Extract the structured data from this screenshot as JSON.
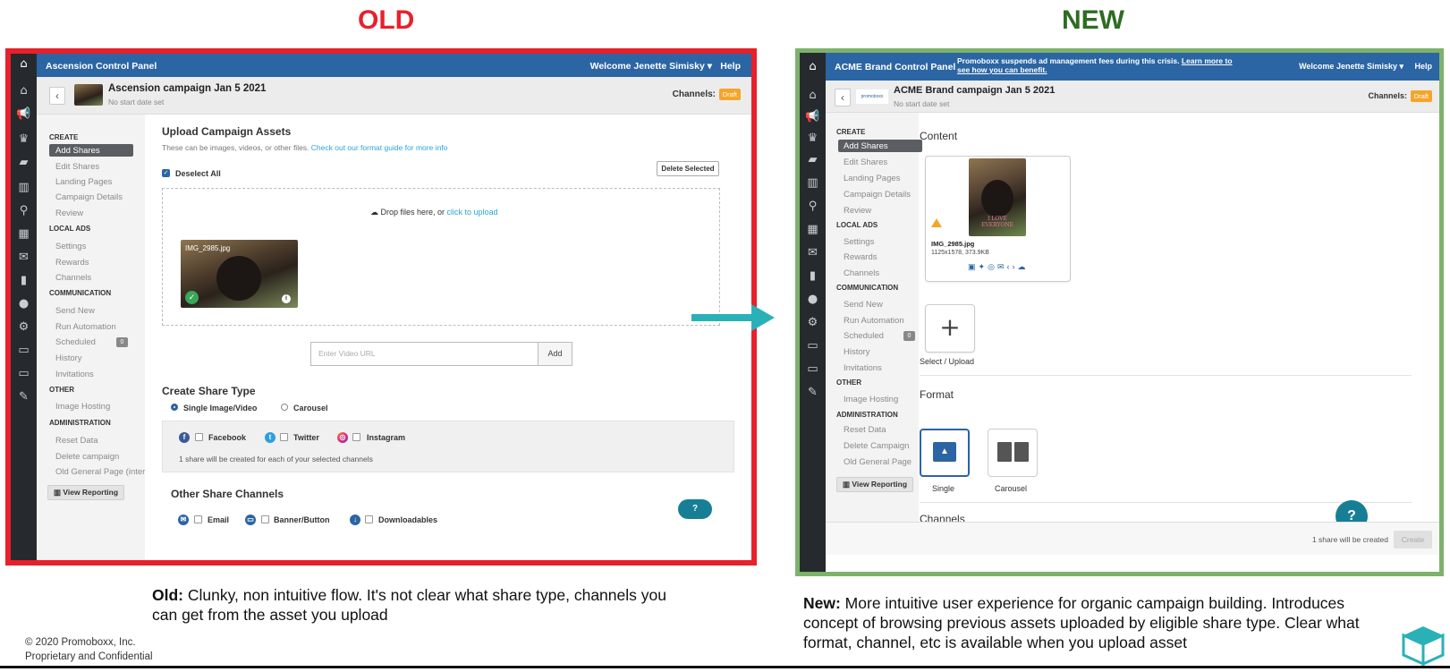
{
  "headings": {
    "old": "OLD",
    "new": "NEW"
  },
  "colors": {
    "old_border": "#e8202a",
    "new_border": "#7db26b",
    "topbar": "#2b65a3",
    "arrow": "#2ab1b8",
    "draft": "#f4a62a"
  },
  "old_panel": {
    "app_title": "Ascension Control Panel",
    "welcome": "Welcome Jenette Simisky ▾",
    "help": "Help",
    "campaign_title": "Ascension campaign Jan 5 2021",
    "campaign_sub": "No start date set",
    "channels_label": "Channels:",
    "draft_badge": "Draft",
    "nav": {
      "create": "CREATE",
      "add_shares": "Add Shares",
      "edit_shares": "Edit Shares",
      "landing_pages": "Landing Pages",
      "campaign_details": "Campaign Details",
      "review": "Review",
      "local_ads": "LOCAL ADS",
      "settings": "Settings",
      "rewards": "Rewards",
      "channels": "Channels",
      "communication": "COMMUNICATION",
      "send_new": "Send New",
      "run_automation": "Run Automation",
      "scheduled": "Scheduled",
      "scheduled_count": "0",
      "history": "History",
      "invitations": "Invitations",
      "other": "OTHER",
      "image_hosting": "Image Hosting",
      "administration": "ADMINISTRATION",
      "reset_data": "Reset Data",
      "delete_campaign": "Delete campaign",
      "old_general_page": "Old General Page (inter",
      "view_reporting": "View Reporting"
    },
    "upload_title": "Upload Campaign Assets",
    "upload_desc": "These can be images, videos, or other files. ",
    "upload_link": "Check out our format guide for more info",
    "deselect_all": "Deselect All",
    "delete_selected": "Delete Selected",
    "drop_text": "Drop files here, or ",
    "drop_link": "click to upload",
    "thumb_name": "IMG_2985.jpg",
    "video_placeholder": "Enter Video URL",
    "add_label": "Add",
    "share_type_title": "Create Share Type",
    "single_label": "Single Image/Video",
    "carousel_label": "Carousel",
    "facebook": "Facebook",
    "twitter": "Twitter",
    "instagram": "Instagram",
    "share_note": "1 share will be created for each of your selected channels",
    "other_channels_title": "Other Share Channels",
    "email": "Email",
    "banner": "Banner/Button",
    "downloadables": "Downloadables",
    "help_bubble": "?"
  },
  "new_panel": {
    "app_title": "ACME Brand Control Panel",
    "notice": "Promoboxx suspends ad management fees during this crisis. ",
    "notice_link": "Learn more to",
    "notice_line2": "see how you can benefit.",
    "welcome": "Welcome Jenette Simisky ▾",
    "help": "Help",
    "brand_logo": "promoboxx",
    "campaign_title": "ACME Brand campaign Jan 5 2021",
    "campaign_sub": "No start date set",
    "channels_label": "Channels:",
    "draft_badge": "Draft",
    "nav": {
      "create": "CREATE",
      "add_shares": "Add Shares",
      "edit_shares": "Edit Shares",
      "landing_pages": "Landing Pages",
      "campaign_details": "Campaign Details",
      "review": "Review",
      "local_ads": "LOCAL ADS",
      "settings": "Settings",
      "rewards": "Rewards",
      "channels": "Channels",
      "communication": "COMMUNICATION",
      "send_new": "Send New",
      "run_automation": "Run Automation",
      "scheduled": "Scheduled",
      "scheduled_count": "0",
      "history": "History",
      "invitations": "Invitations",
      "other": "OTHER",
      "image_hosting": "Image Hosting",
      "administration": "ADMINISTRATION",
      "reset_data": "Reset Data",
      "delete_campaign": "Delete Campaign",
      "old_general_page": "Old General Page",
      "view_reporting": "View Reporting"
    },
    "content_title": "Content",
    "image_text": "I LOVE EVERYONE",
    "asset_name": "IMG_2985.jpg",
    "asset_meta": "1125x1578, 373.9KB",
    "select_upload": "Select / Upload",
    "format_title": "Format",
    "single": "Single",
    "carousel": "Carousel",
    "channels_title": "Channels",
    "share_created": "1 share will be created",
    "create_btn": "Create",
    "help_bubble": "?"
  },
  "captions": {
    "old_bold": "Old:",
    "old_text": " Clunky, non intuitive flow. It's not clear what share type, channels you can get from the asset you upload",
    "new_bold": "New:",
    "new_text": " More intuitive user experience for organic campaign building. Introduces concept of browsing previous assets uploaded by eligible share type. Clear what format, channel, etc is available when you upload asset"
  },
  "copyright": {
    "line1": "© 2020 Promoboxx, Inc.",
    "line2": "Proprietary and Confidential"
  }
}
